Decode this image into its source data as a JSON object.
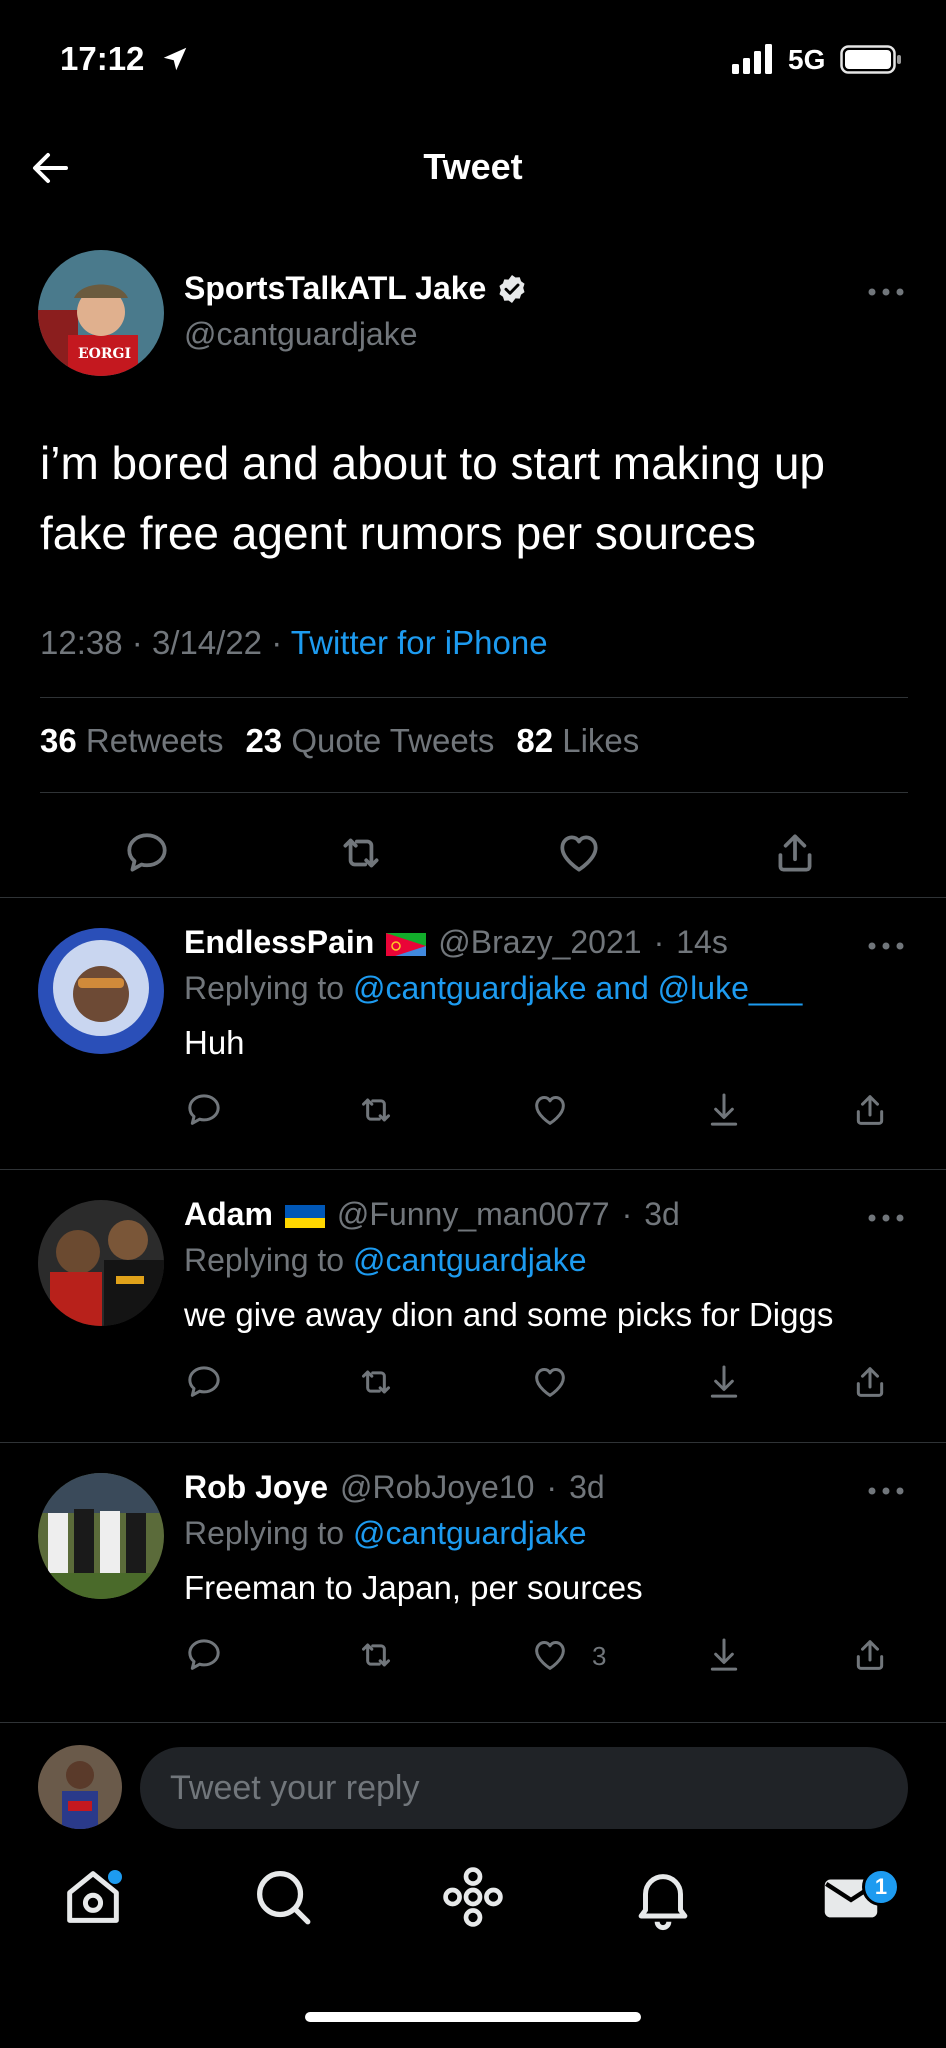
{
  "status_bar": {
    "time": "17:12",
    "network": "5G"
  },
  "header": {
    "title": "Tweet"
  },
  "tweet": {
    "author_name": "SportsTalkATL Jake",
    "author_handle": "@cantguardjake",
    "text": "i’m bored and about to start making up fake free agent rumors per sources",
    "time": "12:38",
    "date": "3/14/22",
    "source": "Twitter for iPhone",
    "retweets_count": "36",
    "retweets_label": "Retweets",
    "quotes_count": "23",
    "quotes_label": "Quote Tweets",
    "likes_count": "82",
    "likes_label": "Likes"
  },
  "replies": [
    {
      "name": "EndlessPain",
      "handle": "@Brazy_2021",
      "age": "14s",
      "replying_prefix": "Replying to",
      "replying_to": "@cantguardjake and @luke___",
      "text": "Huh",
      "like_count": ""
    },
    {
      "name": "Adam",
      "handle": "@Funny_man0077",
      "age": "3d",
      "replying_prefix": "Replying to",
      "replying_to": "@cantguardjake",
      "text": "we give away dion and some picks for Diggs",
      "like_count": ""
    },
    {
      "name": "Rob Joye",
      "handle": "@RobJoye10",
      "age": "3d",
      "replying_prefix": "Replying to",
      "replying_to": "@cantguardjake",
      "text": "Freeman to Japan, per sources",
      "like_count": "3"
    }
  ],
  "composer": {
    "placeholder": "Tweet your reply"
  },
  "tabbar": {
    "messages_badge": "1"
  },
  "colors": {
    "accent": "#1d9bf0",
    "background": "#000000",
    "muted": "#71767b",
    "divider": "#2f3336"
  }
}
